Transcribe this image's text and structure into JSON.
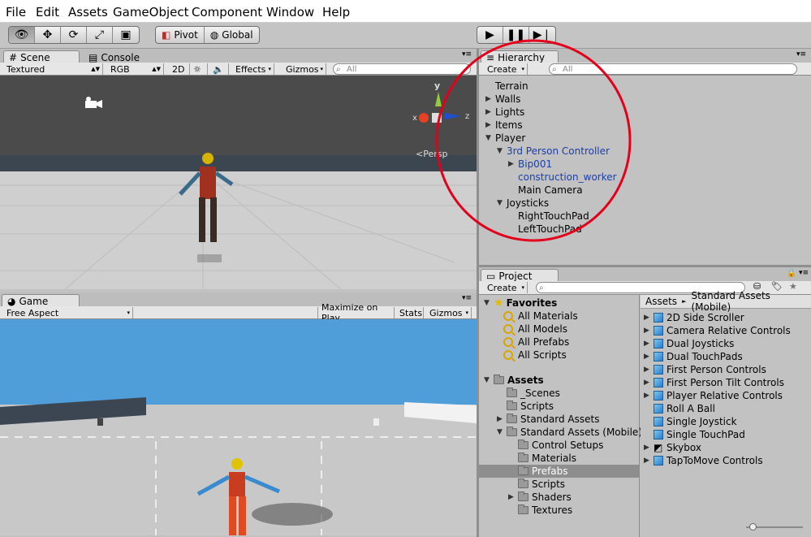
{
  "menu": [
    "File",
    "Edit",
    "Assets",
    "GameObject",
    "Component",
    "Window",
    "Help"
  ],
  "toolbar": {
    "tools": [
      "view-tool",
      "move-tool",
      "rotate-tool",
      "scale-tool",
      "rect-tool"
    ],
    "pivot": "Pivot",
    "global": "Global"
  },
  "scene": {
    "tab_scene": "Scene",
    "tab_console": "Console",
    "draw_mode": "Textured",
    "color_mode": "RGB",
    "btn_2d": "2D",
    "effects": "Effects",
    "gizmos": "Gizmos",
    "search_placeholder": "All",
    "gizmo_x": "x",
    "gizmo_y": "y",
    "gizmo_z": "z",
    "persp": "Persp"
  },
  "game": {
    "tab": "Game",
    "aspect": "Free Aspect",
    "maximize": "Maximize on Play",
    "stats": "Stats",
    "gizmos": "Gizmos"
  },
  "hierarchy": {
    "tab": "Hierarchy",
    "create": "Create",
    "search_placeholder": "All",
    "items": [
      {
        "label": "Terrain",
        "indent": 0,
        "arrow": "",
        "color": "black"
      },
      {
        "label": "Walls",
        "indent": 0,
        "arrow": "right",
        "color": "black"
      },
      {
        "label": "Lights",
        "indent": 0,
        "arrow": "right",
        "color": "black"
      },
      {
        "label": "Items",
        "indent": 0,
        "arrow": "right",
        "color": "black"
      },
      {
        "label": "Player",
        "indent": 0,
        "arrow": "down",
        "color": "black"
      },
      {
        "label": "3rd Person Controller",
        "indent": 1,
        "arrow": "down",
        "color": "blue"
      },
      {
        "label": "Bip001",
        "indent": 2,
        "arrow": "right",
        "color": "blue"
      },
      {
        "label": "construction_worker",
        "indent": 2,
        "arrow": "",
        "color": "blue"
      },
      {
        "label": "Main Camera",
        "indent": 2,
        "arrow": "",
        "color": "black"
      },
      {
        "label": "Joysticks",
        "indent": 1,
        "arrow": "down",
        "color": "black"
      },
      {
        "label": "RightTouchPad",
        "indent": 2,
        "arrow": "",
        "color": "black"
      },
      {
        "label": "LeftTouchPad",
        "indent": 2,
        "arrow": "",
        "color": "black"
      }
    ]
  },
  "project": {
    "tab": "Project",
    "create": "Create",
    "favorites_label": "Favorites",
    "favorites": [
      "All Materials",
      "All Models",
      "All Prefabs",
      "All Scripts"
    ],
    "assets_label": "Assets",
    "folders": [
      {
        "label": "_Scenes",
        "indent": 1,
        "arrow": ""
      },
      {
        "label": "Scripts",
        "indent": 1,
        "arrow": ""
      },
      {
        "label": "Standard Assets",
        "indent": 1,
        "arrow": "right"
      },
      {
        "label": "Standard Assets (Mobile)",
        "indent": 1,
        "arrow": "down"
      },
      {
        "label": "Control Setups",
        "indent": 2,
        "arrow": ""
      },
      {
        "label": "Materials",
        "indent": 2,
        "arrow": ""
      },
      {
        "label": "Prefabs",
        "indent": 2,
        "arrow": "",
        "selected": true
      },
      {
        "label": "Scripts",
        "indent": 2,
        "arrow": ""
      },
      {
        "label": "Shaders",
        "indent": 2,
        "arrow": "right"
      },
      {
        "label": "Textures",
        "indent": 2,
        "arrow": ""
      }
    ],
    "breadcrumb": [
      "Assets",
      "Standard Assets (Mobile)"
    ],
    "breadcrumb_sep": "►",
    "prefabs": [
      {
        "label": "2D Side Scroller",
        "arrow": true
      },
      {
        "label": "Camera Relative Controls",
        "arrow": true
      },
      {
        "label": "Dual Joysticks",
        "arrow": true
      },
      {
        "label": "Dual TouchPads",
        "arrow": true
      },
      {
        "label": "First Person Controls",
        "arrow": true
      },
      {
        "label": "First Person Tilt Controls",
        "arrow": true
      },
      {
        "label": "Player Relative Controls",
        "arrow": true
      },
      {
        "label": "Roll A Ball",
        "arrow": false
      },
      {
        "label": "Single Joystick",
        "arrow": false
      },
      {
        "label": "Single TouchPad",
        "arrow": false
      },
      {
        "label": "Skybox",
        "arrow": true,
        "icon": "skybox"
      },
      {
        "label": "TapToMove Controls",
        "arrow": true
      }
    ]
  }
}
